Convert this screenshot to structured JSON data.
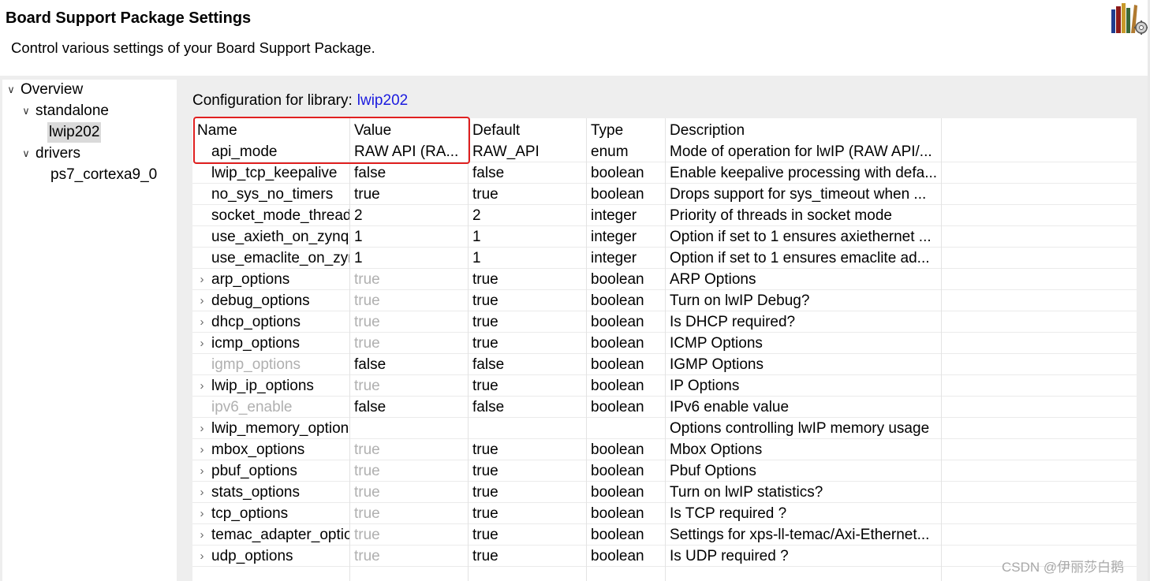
{
  "header": {
    "title": "Board Support Package Settings",
    "description": "Control various settings of your Board Support Package."
  },
  "tree": {
    "overview": "Overview",
    "standalone": "standalone",
    "lwip": "lwip202",
    "drivers": "drivers",
    "cpu": "ps7_cortexa9_0"
  },
  "config": {
    "label": "Configuration for library:",
    "library": "lwip202"
  },
  "table": {
    "headers": [
      "Name",
      "Value",
      "Default",
      "Type",
      "Description"
    ],
    "rows": [
      {
        "name": "api_mode",
        "value": "RAW API (RA...",
        "default": "RAW_API",
        "type": "enum",
        "description": "Mode of operation for lwIP (RAW API/..."
      },
      {
        "name": "lwip_tcp_keepalive",
        "value": "false",
        "default": "false",
        "type": "boolean",
        "description": "Enable keepalive processing with defa..."
      },
      {
        "name": "no_sys_no_timers",
        "value": "true",
        "default": "true",
        "type": "boolean",
        "description": "Drops support for sys_timeout when ..."
      },
      {
        "name": "socket_mode_thread_prio",
        "value": "2",
        "default": "2",
        "type": "integer",
        "description": "Priority of threads in socket mode"
      },
      {
        "name": "use_axieth_on_zynq",
        "value": "1",
        "default": "1",
        "type": "integer",
        "description": "Option if set to 1 ensures axiethernet ..."
      },
      {
        "name": "use_emaclite_on_zynq",
        "value": "1",
        "default": "1",
        "type": "integer",
        "description": "Option if set to 1 ensures emaclite ad..."
      },
      {
        "name": "arp_options",
        "value": "true",
        "default": "true",
        "type": "boolean",
        "description": "ARP Options"
      },
      {
        "name": "debug_options",
        "value": "true",
        "default": "true",
        "type": "boolean",
        "description": "Turn on lwIP Debug?"
      },
      {
        "name": "dhcp_options",
        "value": "true",
        "default": "true",
        "type": "boolean",
        "description": "Is DHCP required?"
      },
      {
        "name": "icmp_options",
        "value": "true",
        "default": "true",
        "type": "boolean",
        "description": "ICMP Options"
      },
      {
        "name": "igmp_options",
        "value": "false",
        "default": "false",
        "type": "boolean",
        "description": "IGMP Options"
      },
      {
        "name": "lwip_ip_options",
        "value": "true",
        "default": "true",
        "type": "boolean",
        "description": "IP Options"
      },
      {
        "name": "ipv6_enable",
        "value": "false",
        "default": "false",
        "type": "boolean",
        "description": "IPv6 enable value"
      },
      {
        "name": "lwip_memory_options",
        "value": "",
        "default": "",
        "type": "",
        "description": "Options controlling lwIP memory usage"
      },
      {
        "name": "mbox_options",
        "value": "true",
        "default": "true",
        "type": "boolean",
        "description": "Mbox Options"
      },
      {
        "name": "pbuf_options",
        "value": "true",
        "default": "true",
        "type": "boolean",
        "description": "Pbuf Options"
      },
      {
        "name": "stats_options",
        "value": "true",
        "default": "true",
        "type": "boolean",
        "description": "Turn on lwIP statistics?"
      },
      {
        "name": "tcp_options",
        "value": "true",
        "default": "true",
        "type": "boolean",
        "description": "Is TCP required ?"
      },
      {
        "name": "temac_adapter_options",
        "value": "true",
        "default": "true",
        "type": "boolean",
        "description": "Settings for xps-ll-temac/Axi-Ethernet..."
      },
      {
        "name": "udp_options",
        "value": "true",
        "default": "true",
        "type": "boolean",
        "description": "Is UDP required ?"
      }
    ]
  },
  "watermark": "CSDN @伊丽莎白鹅",
  "colors": {
    "highlight_border": "#e02020",
    "link": "#1a1adf",
    "disabled_text": "#b0b0b0",
    "panel_bg": "#eeeeee",
    "selection_bg": "#dadada"
  }
}
